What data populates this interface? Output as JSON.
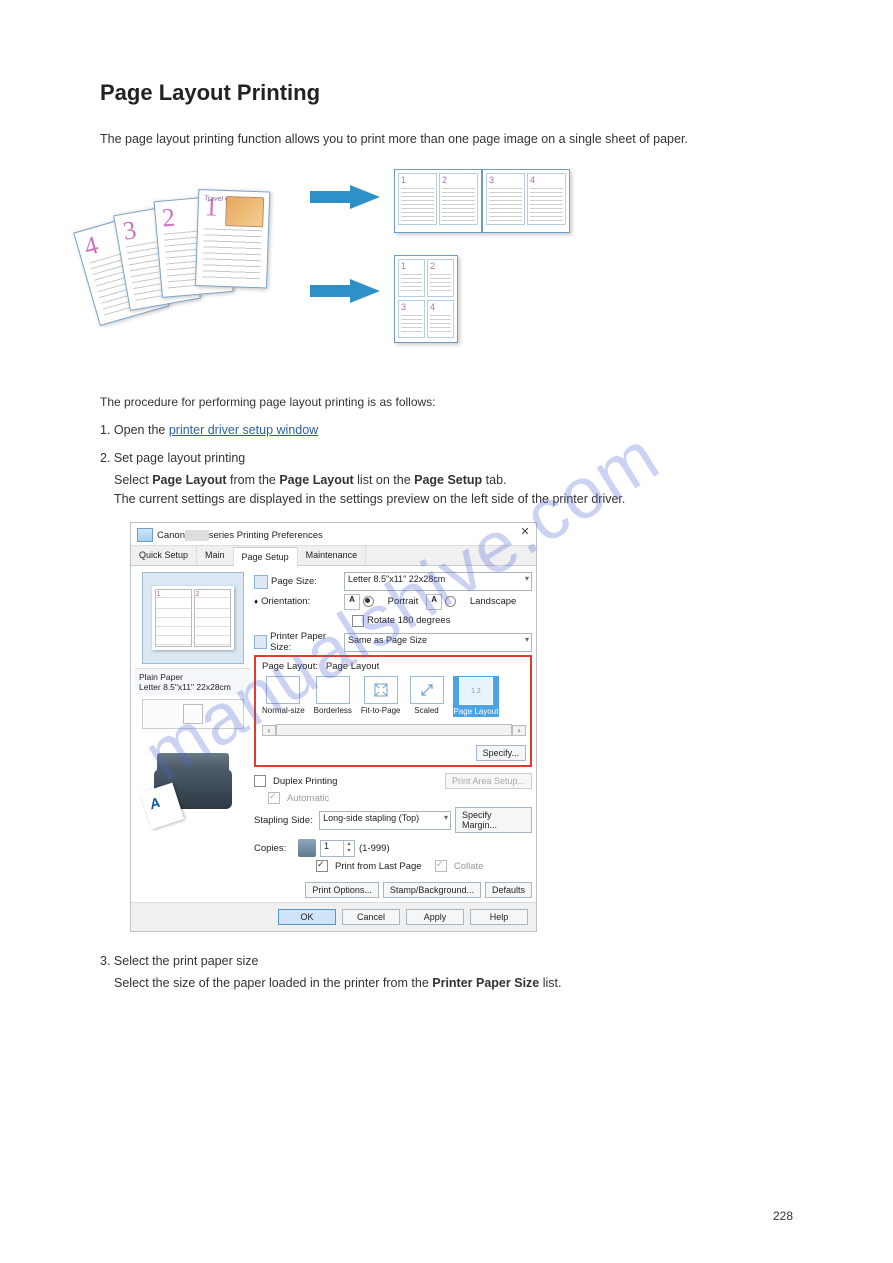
{
  "doc": {
    "title": "Page Layout Printing",
    "intro": "The page layout printing function allows you to print more than one page image on a single sheet of paper.",
    "substeps_label": "The procedure for performing page layout printing is as follows:",
    "step1_num": "1.",
    "step1_text_a": "Open the ",
    "step1_link": "printer driver setup window",
    "step2_num": "2.",
    "step2_text": "Set page layout printing",
    "step2_body_a": "Select ",
    "step2_body_b": "Page Layout",
    "step2_body_c": " from the ",
    "step2_body_d": " list on the ",
    "step2_body_e": "Page Setup",
    "step2_body_f": " tab.",
    "step2_body_g": "The current settings are displayed in the settings preview on the left side of the printer driver.",
    "step3_num": "3.",
    "step3_text": "Select the print paper size",
    "step3_body_a": "Select the size of the paper loaded in the printer from the ",
    "step3_body_b": "Printer Paper Size",
    "step3_body_c": " list.",
    "page_number": "228"
  },
  "dialog": {
    "title_prefix": "Canon ",
    "title_suffix": " series Printing Preferences",
    "tabs": {
      "quick": "Quick Setup",
      "main": "Main",
      "page": "Page Setup",
      "maint": "Maintenance"
    },
    "labels": {
      "page_size": "Page Size:",
      "orientation": "Orientation:",
      "portrait": "Portrait",
      "landscape": "Landscape",
      "rotate": "Rotate 180 degrees",
      "printer_paper_size": "Printer Paper Size:",
      "page_layout_caption": "Page Layout:",
      "page_layout_value": "Page Layout",
      "normal": "Normal-size",
      "borderless": "Borderless",
      "fit": "Fit-to-Page",
      "scaled": "Scaled",
      "page_layout_opt": "Page Layout",
      "specify": "Specify...",
      "duplex": "Duplex Printing",
      "automatic": "Automatic",
      "print_area_setup": "Print Area Setup...",
      "stapling_side": "Stapling Side:",
      "specify_margin": "Specify Margin...",
      "copies": "Copies:",
      "copies_range": "(1-999)",
      "print_last": "Print from Last Page",
      "collate": "Collate",
      "print_options": "Print Options...",
      "stamp": "Stamp/Background...",
      "defaults": "Defaults",
      "ok": "OK",
      "cancel": "Cancel",
      "apply": "Apply",
      "help": "Help"
    },
    "values": {
      "page_size": "Letter 8.5\"x11\" 22x28cm",
      "printer_paper_size": "Same as Page Size",
      "stapling_side": "Long-side stapling (Top)",
      "copies": "1",
      "paper_info_line1": "Plain Paper",
      "paper_info_line2": "Letter 8.5\"x11\" 22x28cm"
    }
  },
  "watermark": "manualshive.com"
}
